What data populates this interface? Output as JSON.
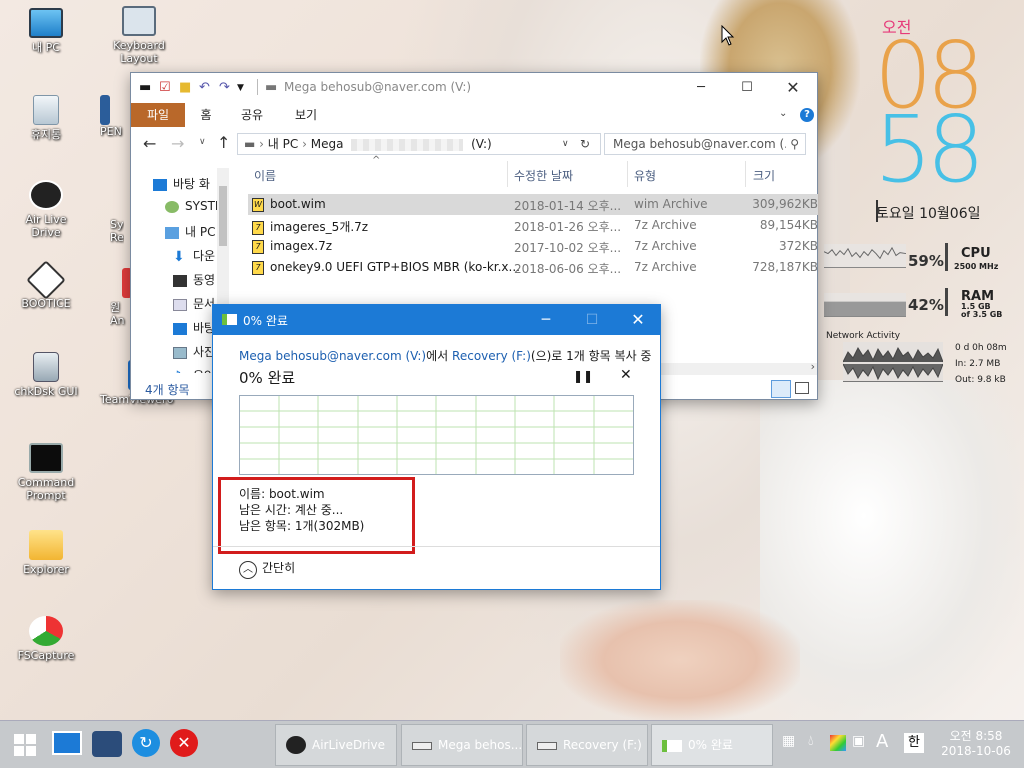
{
  "desktop_icons": [
    {
      "label": "내 PC",
      "icon": "computer-icon"
    },
    {
      "label": "Keyboard Layout",
      "icon": "keyboard-icon"
    },
    {
      "label": "휴지통",
      "icon": "recycle-bin-icon"
    },
    {
      "label": "PEN",
      "icon": "pen-icon"
    },
    {
      "label": "Air Live Drive",
      "icon": "air-live-drive-icon"
    },
    {
      "label": "Sy Re",
      "icon": "system-icon"
    },
    {
      "label": "BOOTICE",
      "icon": "bootice-icon"
    },
    {
      "label": "원 An",
      "icon": "anydesk-icon"
    },
    {
      "label": "chkDsk GUI",
      "icon": "chkdsk-icon"
    },
    {
      "label": "TeamViewer6",
      "icon": "teamviewer-icon"
    },
    {
      "label": "Command Prompt",
      "icon": "command-prompt-icon"
    },
    {
      "label": "Explorer",
      "icon": "folder-icon"
    },
    {
      "label": "FSCapture",
      "icon": "fscapture-icon"
    }
  ],
  "clock_widget": {
    "ampm": "오전",
    "hour": "08",
    "minute": "58",
    "date": "토요일 10월06일",
    "colors": {
      "hour": "#e9a24a",
      "minute": "#47c0e6",
      "ampm": "#e63b7a"
    }
  },
  "system_meters": {
    "cpu": {
      "percent": "59%",
      "name": "CPU",
      "sub": "2500 MHz"
    },
    "ram": {
      "percent": "42%",
      "name": "RAM",
      "sub1": "1.5 GB",
      "sub2": "of  3.5 GB"
    },
    "network": {
      "title": "Network Activity",
      "uptime": "0 d 0h 08m",
      "in": "In: 2.7 MB",
      "out": "Out: 9.8 kB"
    }
  },
  "explorer": {
    "title": "Mega behosub@naver.com (V:)",
    "ribbon_tabs": [
      "파일",
      "홈",
      "공유",
      "보기"
    ],
    "breadcrumb": [
      "내 PC",
      "Mega",
      "(V:)"
    ],
    "search_placeholder": "Mega behosub@naver.com (...",
    "nav_items": [
      "바탕 화",
      "SYSTE",
      "내 PC",
      "다운",
      "동영",
      "문서",
      "바탕",
      "사진",
      "음악"
    ],
    "columns": [
      "이름",
      "수정한 날짜",
      "유형",
      "크기"
    ],
    "files": [
      {
        "name": "boot.wim",
        "date": "2018-01-14 오후...",
        "type": "wim Archive",
        "size": "309,962KB"
      },
      {
        "name": "imageres_5개.7z",
        "date": "2018-01-26 오후...",
        "type": "7z Archive",
        "size": "89,154KB"
      },
      {
        "name": "imagex.7z",
        "date": "2017-10-02 오후...",
        "type": "7z Archive",
        "size": "372KB"
      },
      {
        "name": "onekey9.0 UEFI GTP+BIOS MBR (ko-kr.x...",
        "date": "2018-06-06 오후...",
        "type": "7z Archive",
        "size": "728,187KB"
      }
    ],
    "status": "4개 항목"
  },
  "copy_dialog": {
    "title": "0% 완료",
    "source": "Mega behosub@naver.com (V:)",
    "source_suffix": "에서",
    "dest": "Recovery (F:)",
    "dest_suffix": "(으)로 1개 항목 복사 중",
    "progress_title": "0% 완료",
    "progress_percent": 0,
    "name_line": "이름: boot.wim",
    "time_line": "남은 시간: 계산 중...",
    "items_line": "남은 항목: 1개(302MB)",
    "collapse_label": "간단히"
  },
  "taskbar": {
    "buttons": [
      "AirLiveDrive",
      "Mega behos...",
      "Recovery (F:)",
      "0% 완료"
    ],
    "ime": "한",
    "font_a": "A",
    "time": "오전 8:58",
    "date": "2018-10-06"
  }
}
